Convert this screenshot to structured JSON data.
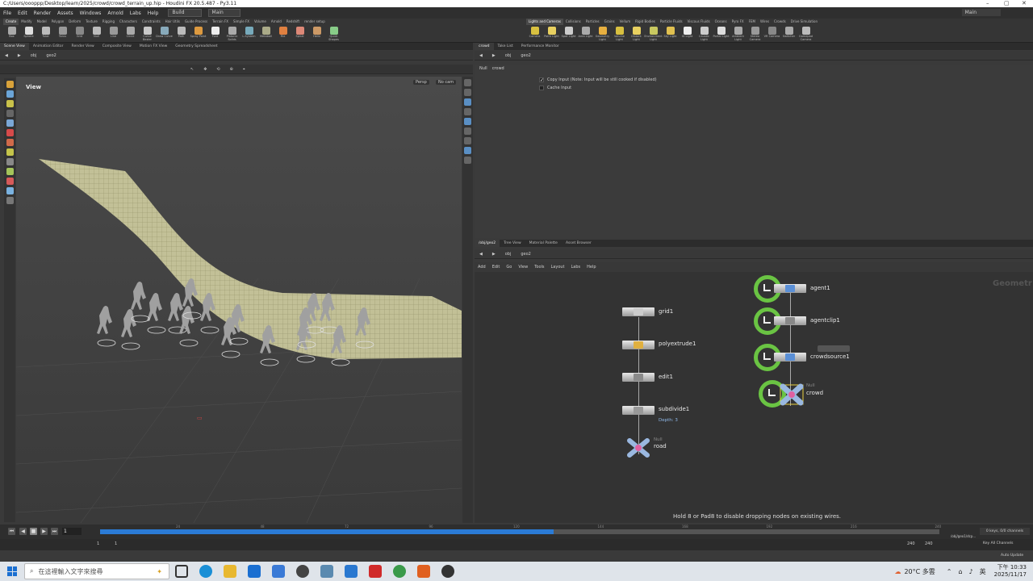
{
  "window": {
    "title": "C:/Users/oooppp/Desktop/learn/2025/crowd/crowd_terrain_up.hip - Houdini FX 20.5.487 - Py3.11"
  },
  "menubar": {
    "items": [
      "File",
      "Edit",
      "Render",
      "Assets",
      "Windows",
      "Arnold",
      "Labs",
      "Help"
    ],
    "desktop": "Build",
    "desktop2": "Main",
    "right_desktop": "Main"
  },
  "shelf_left": {
    "tabs": [
      "Create",
      "Modify",
      "Model",
      "Polygon",
      "Deform",
      "Texture",
      "Rigging",
      "Characters",
      "Constraints",
      "Hair Utils",
      "Guide Process",
      "Terrain FX",
      "Simple FX",
      "Volume",
      "Arnold",
      "Redshift",
      "render setup"
    ],
    "tools": [
      "Box",
      "Sphere",
      "Tube",
      "Torus",
      "Grid",
      "Null",
      "Line",
      "Circle",
      "Curve Bezier",
      "Draw Curve",
      "Path",
      "Spray Paint",
      "Font",
      "Platonic Solids",
      "L-System",
      "Metaball",
      "File",
      "Spiral",
      "Helix",
      "Quick Shapes"
    ]
  },
  "shelf_right": {
    "tabs": [
      "Lights and Cameras",
      "Collisions",
      "Particles",
      "Grains",
      "Vellum",
      "Rigid Bodies",
      "Particle Fluids",
      "Viscous Fluids",
      "Oceans",
      "Pyro FX",
      "FEM",
      "Wires",
      "Crowds",
      "Drive Simulation"
    ],
    "tools": [
      "Camera",
      "Point Light",
      "Spot Light",
      "Area Light",
      "Geometry Light",
      "Volume Light",
      "Distant Light",
      "Environment Light",
      "Sky Light",
      "GI Light",
      "Caustic Light",
      "Portal Light",
      "Ambient Light",
      "Stereo Camera",
      "VR Camera",
      "Switcher",
      "Gamepad Camera"
    ]
  },
  "left_pane": {
    "tabs": [
      "Scene View",
      "Animation Editor",
      "Render View",
      "Composite View",
      "Motion FX View",
      "Geometry Spreadsheet"
    ],
    "path": [
      "obj",
      "geo2"
    ],
    "viewport_label": "View",
    "persp": "Persp",
    "cam": "No cam"
  },
  "params_pane": {
    "tabs": [
      "crowd",
      "Take List",
      "Performance Monitor"
    ],
    "path": [
      "obj",
      "geo2"
    ],
    "node_type": "Null",
    "node_name": "crowd",
    "params": [
      {
        "label": "Copy Input (Note: Input will be still cooked if disabled)",
        "checked": true
      },
      {
        "label": "Cache Input",
        "checked": false
      }
    ]
  },
  "network_pane": {
    "tabs": [
      "/obj/geo2",
      "Tree View",
      "Material Palette",
      "Asset Browser"
    ],
    "path": [
      "obj",
      "geo2"
    ],
    "menu": [
      "Add",
      "Edit",
      "Go",
      "View",
      "Tools",
      "Layout",
      "Labs",
      "Help"
    ],
    "watermark": "Geometr",
    "hint": "Hold 8 or Pad8 to disable dropping nodes on existing wires.",
    "left_chain": [
      {
        "name": "grid1"
      },
      {
        "name": "polyextrude1"
      },
      {
        "name": "edit1"
      },
      {
        "name": "subdivide1",
        "sub": "Depth: 3"
      },
      {
        "name": "road",
        "type": "Null"
      }
    ],
    "right_chain": [
      {
        "name": "agent1"
      },
      {
        "name": "agentclip1"
      },
      {
        "name": "crowdsource1"
      },
      {
        "name": "crowd",
        "type": "Null"
      }
    ]
  },
  "timeline": {
    "current_frame": "1",
    "start": "1",
    "end_start": "1",
    "end": "240",
    "end2": "240",
    "ticks": [
      "24",
      "48",
      "72",
      "96",
      "120",
      "144",
      "168",
      "192",
      "216",
      "240"
    ],
    "progress_fraction": 0.54,
    "keys_info": "0 keys, 0/0 channels",
    "key_all": "Key All Channels",
    "auto_update": "Auto Update",
    "path_field": "/obj/geo1/dcp..."
  },
  "taskbar": {
    "search_placeholder": "在這裡輸入文字來搜尋",
    "weather": "20°C 多雲",
    "ime": "英",
    "time": "下午 10:33",
    "date": "2025/11/17"
  },
  "colors": {
    "accent_blue": "#2b7bd6",
    "ring_green": "#6ac443",
    "terrain": "#d8d6a6"
  }
}
